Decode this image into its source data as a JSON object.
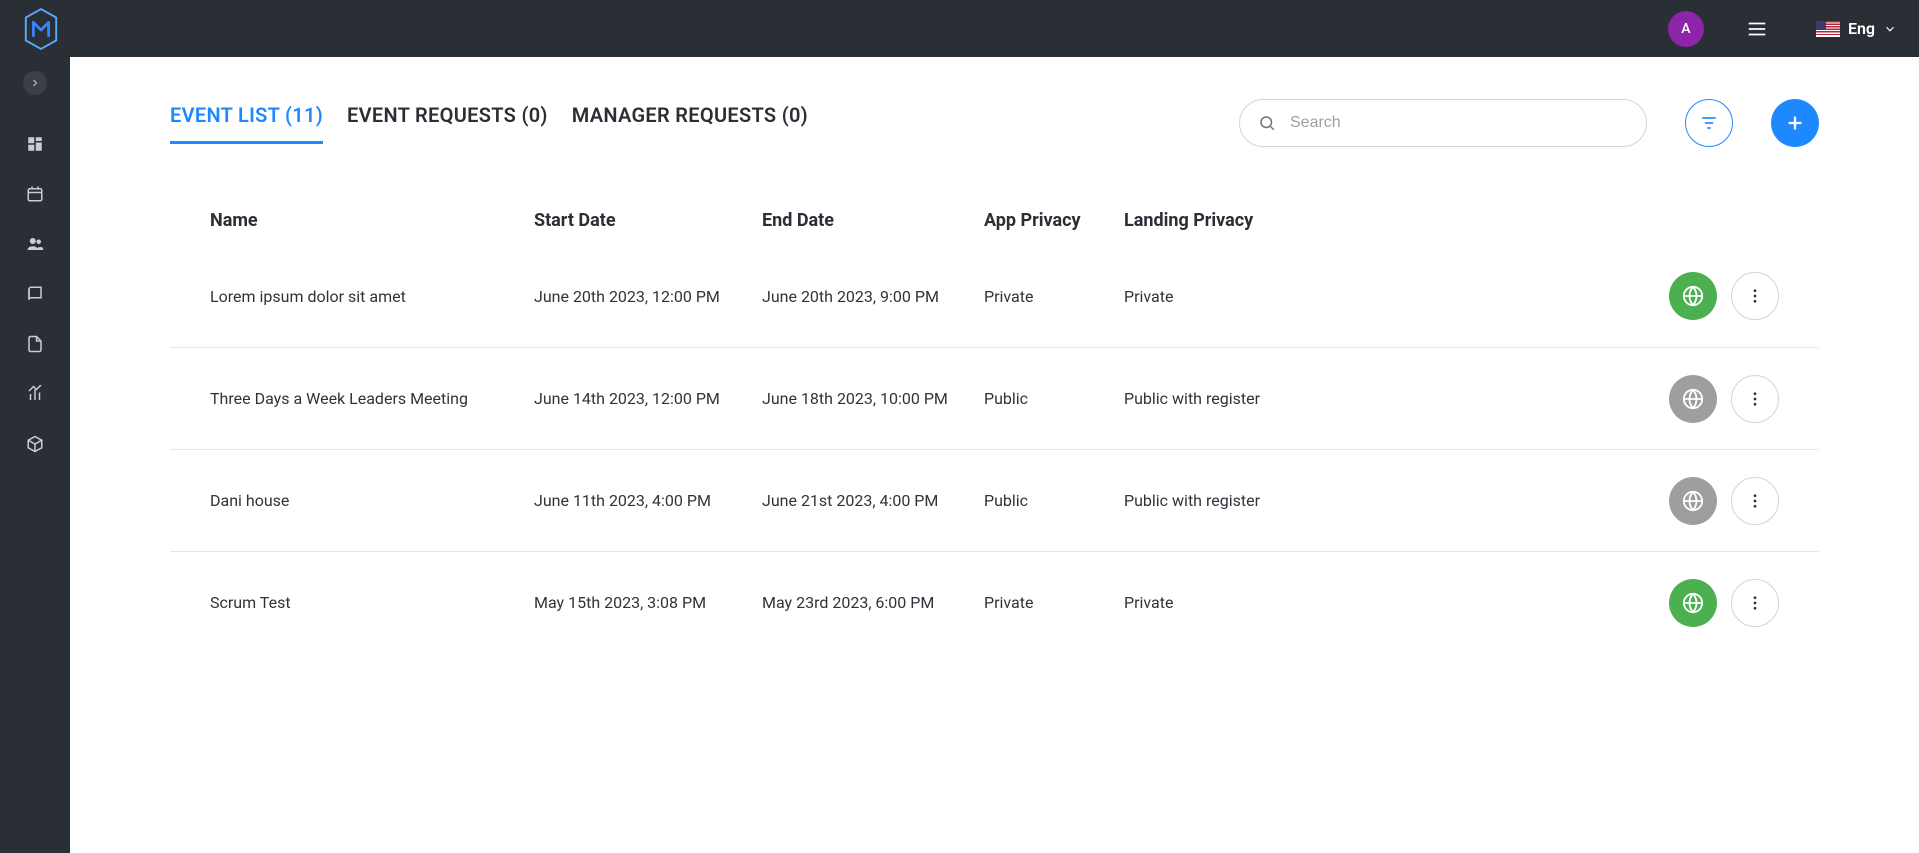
{
  "header": {
    "avatar_initial": "A",
    "language_label": "Eng"
  },
  "tabs": [
    {
      "label": "EVENT LIST (11)",
      "active": true
    },
    {
      "label": "EVENT REQUESTS (0)",
      "active": false
    },
    {
      "label": "MANAGER REQUESTS (0)",
      "active": false
    }
  ],
  "search": {
    "placeholder": "Search",
    "value": ""
  },
  "table": {
    "columns": [
      "Name",
      "Start Date",
      "End Date",
      "App Privacy",
      "Landing Privacy"
    ],
    "rows": [
      {
        "name": "Lorem ipsum dolor sit amet",
        "start_date": "June 20th 2023, 12:00 PM",
        "end_date": "June 20th 2023, 9:00 PM",
        "app_privacy": "Private",
        "landing_privacy": "Private",
        "globe_color": "green"
      },
      {
        "name": "Three Days a Week Leaders Meeting",
        "start_date": "June 14th 2023, 12:00 PM",
        "end_date": "June 18th 2023, 10:00 PM",
        "app_privacy": "Public",
        "landing_privacy": "Public with register",
        "globe_color": "grey"
      },
      {
        "name": "Dani house",
        "start_date": "June 11th 2023, 4:00 PM",
        "end_date": "June 21st 2023, 4:00 PM",
        "app_privacy": "Public",
        "landing_privacy": "Public with register",
        "globe_color": "grey"
      },
      {
        "name": "Scrum Test",
        "start_date": "May 15th 2023, 3:08 PM",
        "end_date": "May 23rd 2023, 6:00 PM",
        "app_privacy": "Private",
        "landing_privacy": "Private",
        "globe_color": "green"
      }
    ]
  }
}
